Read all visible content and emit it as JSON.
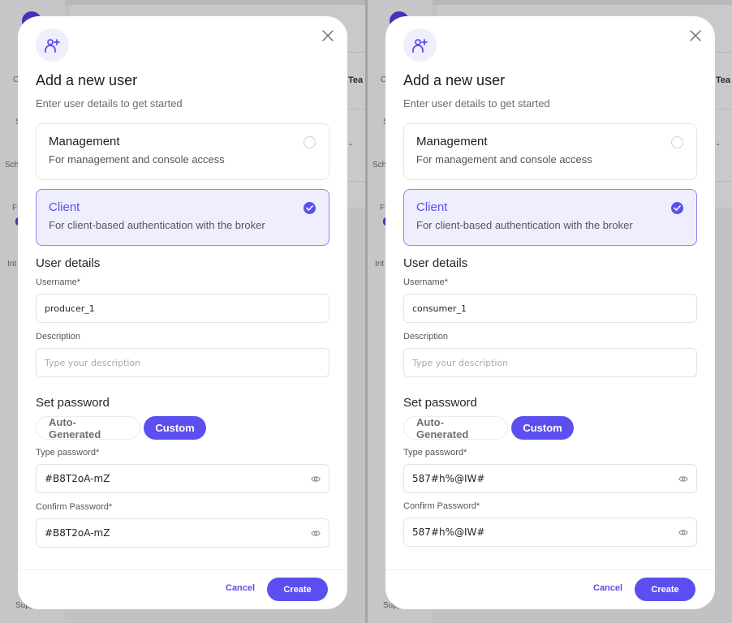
{
  "background_app": {
    "sidebar_labels": [
      "C",
      "S",
      "Sch",
      "F",
      "Int",
      "Supp"
    ],
    "table_header_fragment": "Tea",
    "table_cell_fragment": "-"
  },
  "dialogs": [
    {
      "title": "Add a new user",
      "subtitle": "Enter user details to get started",
      "header_icon": "user-plus-icon",
      "close_icon": "close-icon",
      "roles": [
        {
          "title": "Management",
          "description": "For management and console access",
          "selected": false
        },
        {
          "title": "Client",
          "description": "For client-based authentication with the broker",
          "selected": true
        }
      ],
      "user_details_heading": "User details",
      "username_label": "Username*",
      "username_value": "producer_1",
      "description_label": "Description",
      "description_placeholder": "Type your description",
      "description_value": "",
      "set_password_heading": "Set password",
      "password_modes": [
        {
          "label": "Auto-Generated",
          "active": false
        },
        {
          "label": "Custom",
          "active": true
        }
      ],
      "type_password_label": "Type password*",
      "type_password_value": "#B8T2oA-mZ",
      "confirm_password_label": "Confirm Password*",
      "confirm_password_value": "#B8T2oA-mZ",
      "password_visibility_icon": "eye-icon",
      "cancel_label": "Cancel",
      "create_label": "Create"
    },
    {
      "title": "Add a new user",
      "subtitle": "Enter user details to get started",
      "header_icon": "user-plus-icon",
      "close_icon": "close-icon",
      "roles": [
        {
          "title": "Management",
          "description": "For management and console access",
          "selected": false
        },
        {
          "title": "Client",
          "description": "For client-based authentication with the broker",
          "selected": true
        }
      ],
      "user_details_heading": "User details",
      "username_label": "Username*",
      "username_value": "consumer_1",
      "description_label": "Description",
      "description_placeholder": "Type your description",
      "description_value": "",
      "set_password_heading": "Set password",
      "password_modes": [
        {
          "label": "Auto-Generated",
          "active": false
        },
        {
          "label": "Custom",
          "active": true
        }
      ],
      "type_password_label": "Type password*",
      "type_password_value": "587#h%@IW#",
      "confirm_password_label": "Confirm Password*",
      "confirm_password_value": "587#h%@IW#",
      "password_visibility_icon": "eye-icon",
      "cancel_label": "Cancel",
      "create_label": "Create"
    }
  ],
  "colors": {
    "accent": "#5b50ef",
    "accent_text": "#5a4fe6",
    "selected_card_bg": "#efeefd",
    "selected_card_border": "#8d84f3",
    "overlay": "#c4c4c6"
  }
}
